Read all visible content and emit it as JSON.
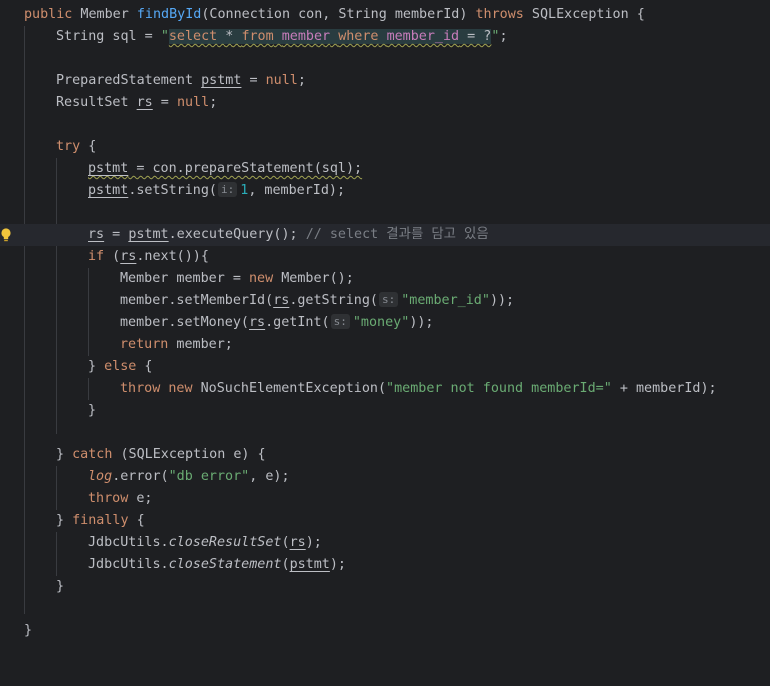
{
  "editor": {
    "l1": {
      "k1": "public",
      "t1": " Member ",
      "f": "findById",
      "t2": "(Connection con, String memberId) ",
      "k2": "throws",
      "t3": " SQLException {"
    },
    "l2": {
      "t1": "String sql = ",
      "q1": "\"",
      "s1": "select",
      "s2": " * ",
      "s3": "from",
      "s4": " ",
      "s5": "member",
      "s6": " ",
      "s7": "where",
      "s8": " ",
      "s9": "member_id",
      "s10": " = ?",
      "q2": "\"",
      "t2": ";"
    },
    "l4": {
      "t1": "PreparedStatement ",
      "v": "pstmt",
      "t2": " = ",
      "k": "null",
      "t3": ";"
    },
    "l5": {
      "t1": "ResultSet ",
      "v": "rs",
      "t2": " = ",
      "k": "null",
      "t3": ";"
    },
    "l7": {
      "k": "try",
      "t": " {"
    },
    "l8": {
      "v": "pstmt",
      "t": " = con.prepareStatement(sql);"
    },
    "l9": {
      "v": "pstmt",
      "t1": ".setString(",
      "h": "i:",
      "n": "1",
      "t2": ", memberId);"
    },
    "l11": {
      "v1": "rs",
      "t1": " = ",
      "v2": "pstmt",
      "t2": ".executeQuery(); ",
      "c": "// select 결과를 담고 있음"
    },
    "l12": {
      "k": "if",
      "t1": " (",
      "v": "rs",
      "t2": ".next()){"
    },
    "l13": {
      "t1": "Member member = ",
      "k": "new",
      "t2": " Member();"
    },
    "l14": {
      "t1": "member.setMemberId(",
      "v": "rs",
      "t2": ".getString(",
      "h": "s:",
      "s": "\"member_id\"",
      "t3": "));"
    },
    "l15": {
      "t1": "member.setMoney(",
      "v": "rs",
      "t2": ".getInt(",
      "h": "s:",
      "s": "\"money\"",
      "t3": "));"
    },
    "l16": {
      "k": "return",
      "t": " member;"
    },
    "l17": {
      "t1": "} ",
      "k": "else",
      "t2": " {"
    },
    "l18": {
      "k1": "throw",
      "t1": " ",
      "k2": "new",
      "t2": " NoSuchElementException(",
      "s": "\"member not found memberId=\"",
      "t3": " + memberId);"
    },
    "l19": {
      "t": "}"
    },
    "l21": {
      "t1": "} ",
      "k": "catch",
      "t2": " (SQLException e) {"
    },
    "l22": {
      "v": "log",
      "t1": ".error(",
      "s": "\"db error\"",
      "t2": ", e);"
    },
    "l23": {
      "k": "throw",
      "t": " e;"
    },
    "l24": {
      "t1": "} ",
      "k": "finally",
      "t2": " {"
    },
    "l25": {
      "t1": "JdbcUtils.",
      "m": "closeResultSet",
      "t2": "(",
      "v": "rs",
      "t3": ");"
    },
    "l26": {
      "t1": "JdbcUtils.",
      "m": "closeStatement",
      "t2": "(",
      "v": "pstmt",
      "t3": ");"
    },
    "l27": {
      "t": "}"
    },
    "l29": {
      "t": "}"
    }
  },
  "colors": {
    "background": "#1e1f22",
    "text": "#bcbec4",
    "keyword": "#cf8e6d",
    "function": "#56a8f5",
    "string": "#6aab73",
    "number": "#2aacb8",
    "comment": "#7a7e85",
    "sql_identifier": "#c77dbb",
    "intention_bulb": "#f0c43c"
  },
  "icons": {
    "gutter": "lightbulb-icon"
  }
}
